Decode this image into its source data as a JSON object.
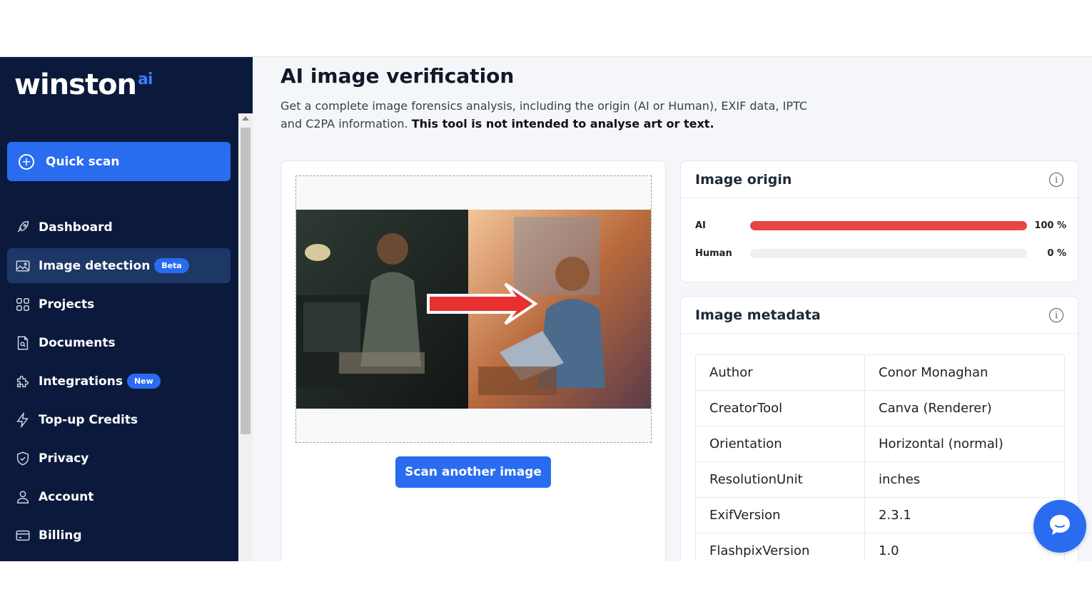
{
  "brand": {
    "name": "winston",
    "suffix": "ai"
  },
  "sidebar": {
    "quick_scan": "Quick scan",
    "items": [
      {
        "label": "Dashboard",
        "icon": "rocket-icon"
      },
      {
        "label": "Image detection",
        "icon": "image-icon",
        "badge": "Beta",
        "active": true
      },
      {
        "label": "Projects",
        "icon": "grid-icon"
      },
      {
        "label": "Documents",
        "icon": "document-icon"
      },
      {
        "label": "Integrations",
        "icon": "puzzle-icon",
        "badge": "New"
      },
      {
        "label": "Top-up Credits",
        "icon": "lightning-icon"
      },
      {
        "label": "Privacy",
        "icon": "shield-icon"
      },
      {
        "label": "Account",
        "icon": "user-icon"
      },
      {
        "label": "Billing",
        "icon": "credit-card-icon"
      }
    ]
  },
  "main": {
    "title": "AI image verification",
    "description": "Get a complete image forensics analysis, including the origin (AI or Human), EXIF data, IPTC and C2PA information.",
    "description_bold": "This tool is not intended to analyse art or text.",
    "scan_button": "Scan another image"
  },
  "origin": {
    "title": "Image origin",
    "rows": [
      {
        "label": "AI",
        "value": 100,
        "text": "100 %"
      },
      {
        "label": "Human",
        "value": 0,
        "text": "0 %"
      }
    ]
  },
  "metadata": {
    "title": "Image metadata",
    "rows": [
      {
        "key": "Author",
        "value": "Conor Monaghan"
      },
      {
        "key": "CreatorTool",
        "value": "Canva (Renderer)"
      },
      {
        "key": "Orientation",
        "value": "Horizontal (normal)"
      },
      {
        "key": "ResolutionUnit",
        "value": "inches"
      },
      {
        "key": "ExifVersion",
        "value": "2.3.1"
      },
      {
        "key": "FlashpixVersion",
        "value": "1.0"
      }
    ]
  },
  "colors": {
    "sidebar": "#0b1a3c",
    "accent": "#2a6cf0",
    "ai_bar": "#e84545"
  }
}
